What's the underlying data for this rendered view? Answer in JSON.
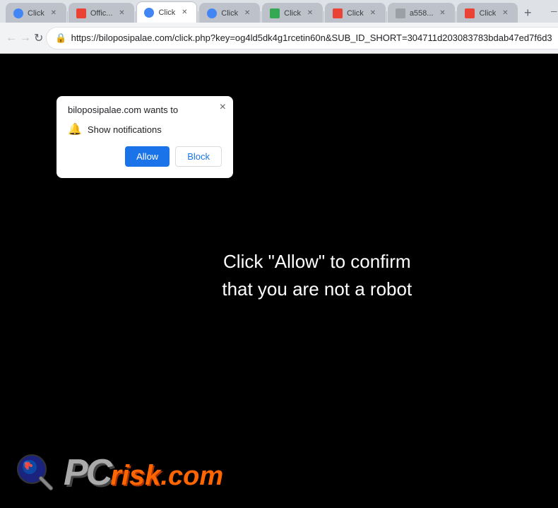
{
  "browser": {
    "tabs": [
      {
        "id": "tab1",
        "label": "Click",
        "favicon_color": "#4285f4",
        "active": false
      },
      {
        "id": "tab2",
        "label": "Offic...",
        "favicon_color": "#ea4335",
        "active": false
      },
      {
        "id": "tab3",
        "label": "Click",
        "favicon_color": "#4285f4",
        "active": true
      },
      {
        "id": "tab4",
        "label": "Click",
        "favicon_color": "#4285f4",
        "active": false
      },
      {
        "id": "tab5",
        "label": "Click",
        "favicon_color": "#34a853",
        "active": false
      },
      {
        "id": "tab6",
        "label": "Click",
        "favicon_color": "#ea4335",
        "active": false
      },
      {
        "id": "tab7",
        "label": "a558...",
        "favicon_color": "#9aa0a6",
        "active": false
      },
      {
        "id": "tab8",
        "label": "Click",
        "favicon_color": "#ea4335",
        "active": false
      }
    ],
    "new_tab_label": "+",
    "address": "https://biloposipalae.com/click.php?key=og4ld5dk4g1rcetin60n&SUB_ID_SHORT=304711d203083783bdab47ed7f6d3",
    "nav": {
      "back": "←",
      "forward": "→",
      "reload": "↻"
    },
    "window_controls": {
      "minimize": "─",
      "maximize": "□",
      "close": "✕"
    }
  },
  "popup": {
    "title": "biloposipalae.com wants to",
    "row_text": "Show notifications",
    "allow_label": "Allow",
    "block_label": "Block",
    "close_label": "×"
  },
  "page": {
    "main_text_line1": "Click \"Allow\" to confirm",
    "main_text_line2": "that you are not a robot"
  },
  "logo": {
    "pc_text": "PC",
    "risk_text": "risk",
    "dotcom_text": ".com"
  }
}
